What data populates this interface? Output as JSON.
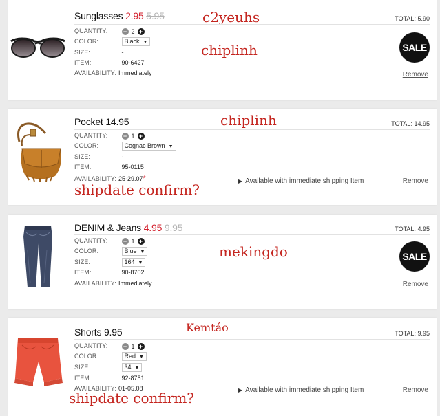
{
  "labels": {
    "quantity": "QUANTITY:",
    "color": "COLOR:",
    "size": "SIZE:",
    "item": "ITEM:",
    "availability": "AVAILABILITY:",
    "total": "TOTAL:",
    "remove": "Remove",
    "sale": "SALE",
    "shipping_link": "Available with immediate shipping Item"
  },
  "items": [
    {
      "name": "Sunglasses",
      "price": "2.95",
      "old_price": "5.95",
      "quantity": "2",
      "color": "Black",
      "size": "-",
      "item_no": "90-6427",
      "availability": "Immediately",
      "total": "5.90",
      "note": "c2yeuhs",
      "note2": "chiplinh"
    },
    {
      "name": "Pocket",
      "price": "14.95",
      "quantity": "1",
      "color": "Cognac Brown",
      "size": "-",
      "item_no": "95-0115",
      "availability": "25-29.07",
      "availability_mark": "*",
      "total": "14.95",
      "note": "chiplinh",
      "note2": "shipdate confirm?"
    },
    {
      "name": "DENIM & Jeans",
      "price": "4.95",
      "old_price": "9.95",
      "quantity": "1",
      "color": "Blue",
      "size": "164",
      "item_no": "90-8702",
      "availability": "Immediately",
      "total": "4.95",
      "note": "mekingdo"
    },
    {
      "name": "Shorts",
      "price": "9.95",
      "quantity": "1",
      "color": "Red",
      "size": "34",
      "item_no": "92-8751",
      "availability": "01-05.08",
      "total": "9.95",
      "note": "Kemtáo",
      "note2": "shipdate confirm?"
    }
  ]
}
